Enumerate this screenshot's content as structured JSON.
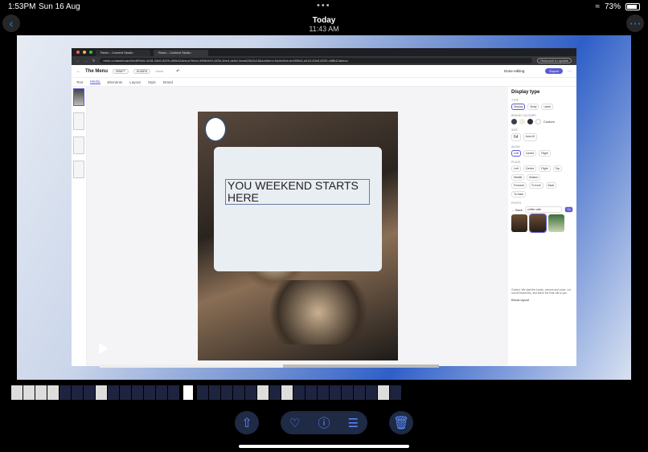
{
  "status": {
    "time": "1:53PM",
    "date": "Sun 16 Aug",
    "battery": "73%"
  },
  "nav": {
    "title": "Today",
    "subtitle": "11:43 AM"
  },
  "browser": {
    "tabs": [
      "Reelo - Content Studio",
      "Reelo - Content Studio"
    ],
    "url": "reelo.co/dashboard/#c4f59d4-d418-43e6-8209-cf8fb42abeca?item=4ff4fc0e9-445b-4be4-ae6d-4cea62843c18&subitem=folder&id=#c4f59d4-d418-43e6-8209-cf8fb42abeca",
    "relaunch": "Relaunch to update"
  },
  "app": {
    "title": "The Menu",
    "draft": "DRAFT",
    "guided": "GUIDED",
    "saved": "Saved",
    "done_editing": "Done editing",
    "export": "Export",
    "subtabs": [
      "Text",
      "Media",
      "Elements",
      "Layout",
      "Style",
      "Brand"
    ]
  },
  "poster": {
    "headline": "YOU WEEKEND STARTS HERE"
  },
  "panel": {
    "heading": "Display type",
    "type_label": "TYPE",
    "type_options": [
      "Display",
      "Body",
      "Label"
    ],
    "brand_label": "BRAND COLOURS",
    "custom": "Custom",
    "size_label": "SIZE",
    "size_value": "64",
    "auto_fit": "Auto-fit",
    "align_label": "ALIGN",
    "align_options": [
      "Left",
      "Centre",
      "Right"
    ],
    "place_label": "PLACE",
    "place_options": [
      "Left",
      "Centre",
      "Right",
      "Top",
      "Middle",
      "Bottom"
    ],
    "layer_options": [
      "Forward",
      "To front",
      "Back",
      "To back"
    ],
    "photo_label": "PHOTO",
    "back": "← Back",
    "search_value": "coffee cafe",
    "go": "Go",
    "guided_note": "Guided. We start the hooks, colours and voice, cut out off-brand bits, and leave the final call to you.",
    "break_layout": "Break layout"
  },
  "toolbar": {
    "share_icon": "share-icon",
    "heart_icon": "heart-icon",
    "info_icon": "info-icon",
    "adjust_icon": "adjust-icon",
    "trash_icon": "trash-icon"
  },
  "colors": {
    "accent": "#0a84ff",
    "app_accent": "#5b5bd6",
    "toolbar_bg": "#1f2a45"
  }
}
